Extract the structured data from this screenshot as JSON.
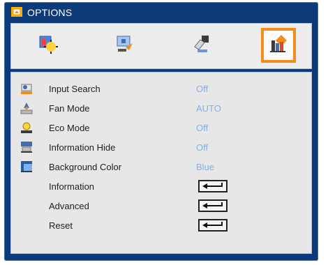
{
  "window": {
    "title": "OPTIONS"
  },
  "tabs": [
    {
      "icon": "image-settings-icon",
      "active": false
    },
    {
      "icon": "display-settings-icon",
      "active": false
    },
    {
      "icon": "setup-settings-icon",
      "active": false
    },
    {
      "icon": "options-icon",
      "active": true
    }
  ],
  "menu": {
    "items": [
      {
        "label": "Input Search",
        "value": "Off",
        "icon": "input-search-icon"
      },
      {
        "label": "Fan Mode",
        "value": "AUTO",
        "icon": "fan-icon"
      },
      {
        "label": "Eco Mode",
        "value": "Off",
        "icon": "eco-mode-icon"
      },
      {
        "label": "Information Hide",
        "value": "Off",
        "icon": "info-hide-icon"
      },
      {
        "label": "Background Color",
        "value": "Blue",
        "icon": "background-color-icon"
      },
      {
        "label": "Information",
        "control": "enter-arrow-icon"
      },
      {
        "label": "Advanced",
        "control": "enter-arrow-icon"
      },
      {
        "label": "Reset",
        "control": "enter-arrow-icon"
      }
    ]
  },
  "colors": {
    "frame": "#0d3a78",
    "panel": "#e7e7e7",
    "active_tab": "#f28c1d",
    "value_text": "#7fb0ec"
  }
}
